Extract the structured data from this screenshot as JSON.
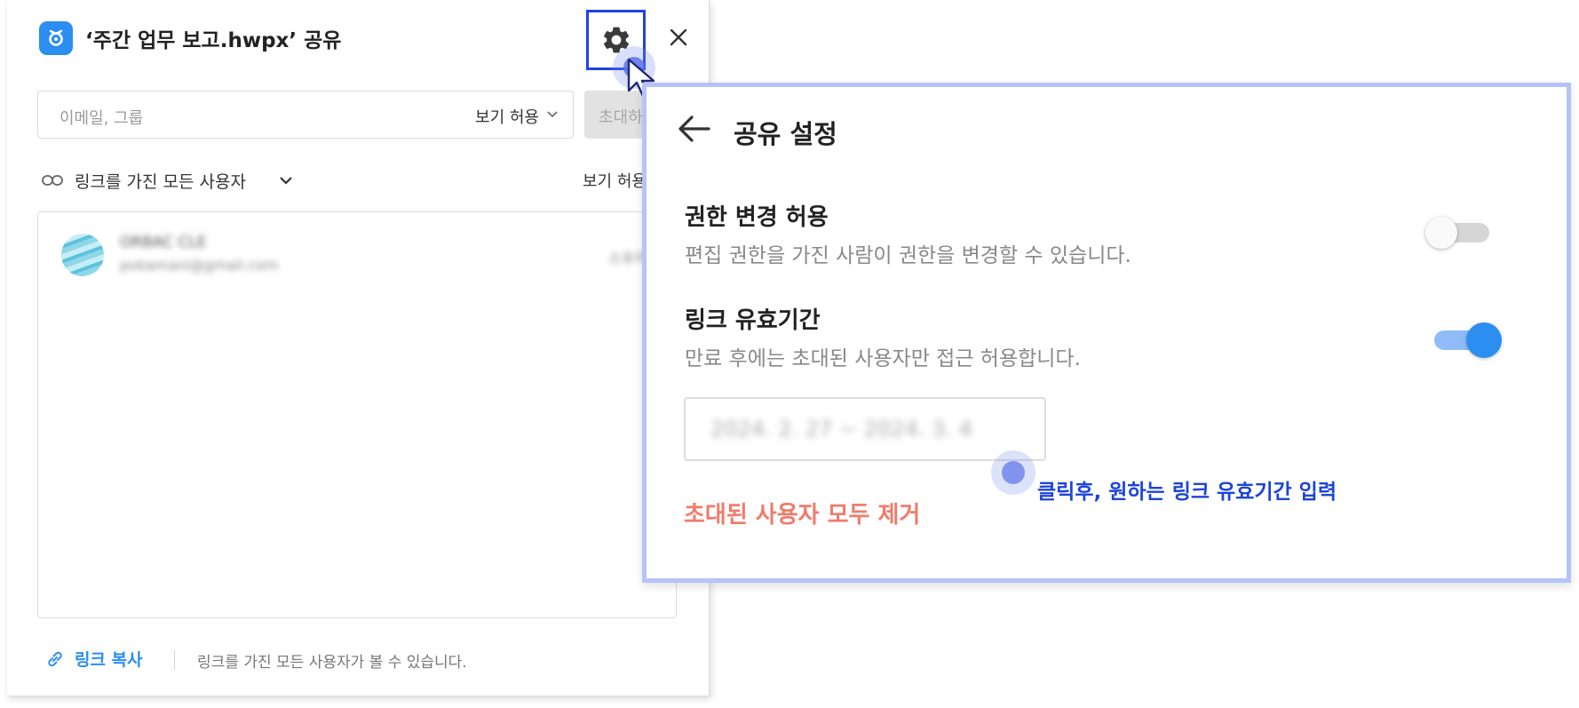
{
  "dialog": {
    "title": "‘주간 업무 보고.hwpx’ 공유",
    "invite": {
      "placeholder": "이메일, 그룹",
      "permission": "보기 허용",
      "button": "초대하기"
    },
    "link_scope": "링크를 가진 모든 사용자",
    "link_permission": "보기 허용",
    "member": {
      "name": "ORBAC CLE",
      "email": "pokamani@gmail.com",
      "role": "소유자"
    },
    "footer": {
      "copy_link": "링크 복사",
      "note": "링크를 가진 모든 사용자가 볼 수 있습니다."
    }
  },
  "settings": {
    "title": "공유 설정",
    "options": [
      {
        "title": "권한 변경 허용",
        "description": "편집 권한을 가진 사람이 권한을 변경할 수 있습니다.",
        "enabled": false
      },
      {
        "title": "링크 유효기간",
        "description": "만료 후에는 초대된 사용자만 접근 허용합니다.",
        "enabled": true
      }
    ],
    "date_range": "2024. 2. 27 ~ 2024. 3. 4",
    "remove_all": "초대된 사용자 모두 제거"
  },
  "annotation": {
    "hint": "클릭후, 원하는 링크 유효기간 입력"
  },
  "colors": {
    "accent": "#2b8ef0",
    "highlight_border": "#2142e0",
    "panel_border": "#b5c3f9",
    "danger": "#f07b6c",
    "hint_text": "#1d44d8"
  },
  "icons": [
    "app-icon",
    "gear-icon",
    "close-icon",
    "chevron-down-icon",
    "link-icon",
    "back-arrow-icon",
    "cursor-icon"
  ]
}
